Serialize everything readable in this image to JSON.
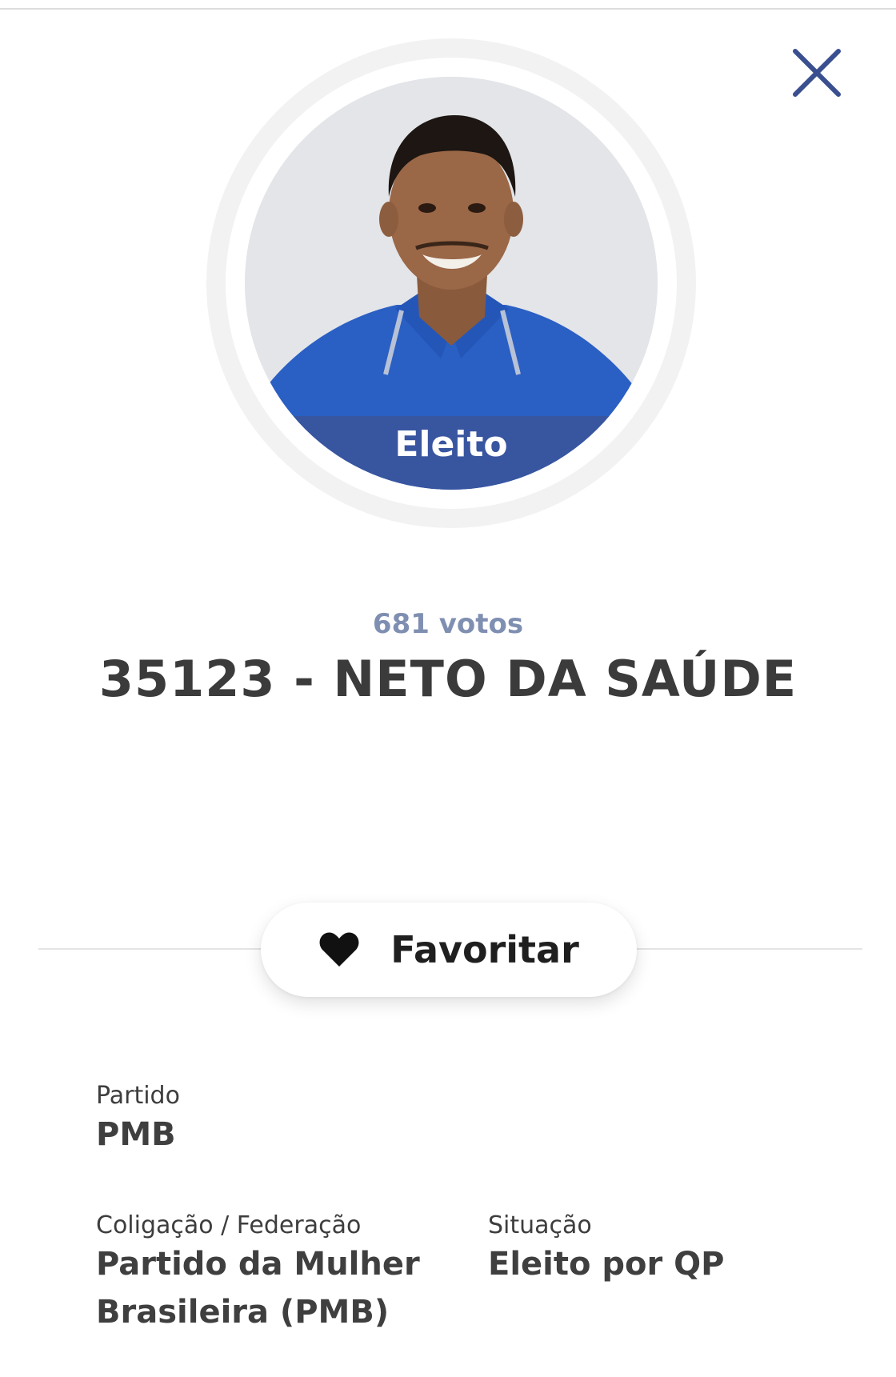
{
  "header": {
    "close_icon": "close-icon"
  },
  "candidate": {
    "status_badge": "Eleito",
    "votes_text": "681 votos",
    "title": "35123 - NETO DA SAÚDE"
  },
  "actions": {
    "favorite_icon": "heart-icon",
    "favorite_label": "Favoritar"
  },
  "details": {
    "party_label": "Partido",
    "party_value": "PMB",
    "coalition_label": "Coligação / Federação",
    "coalition_value_line1": "Partido da Mulher",
    "coalition_value_line2": "Brasileira (PMB)",
    "situation_label": "Situação",
    "situation_value": "Eleito por QP"
  },
  "colors": {
    "accent": "#3855a0",
    "votes": "#7f8fb1",
    "text": "#3b3b3b"
  }
}
